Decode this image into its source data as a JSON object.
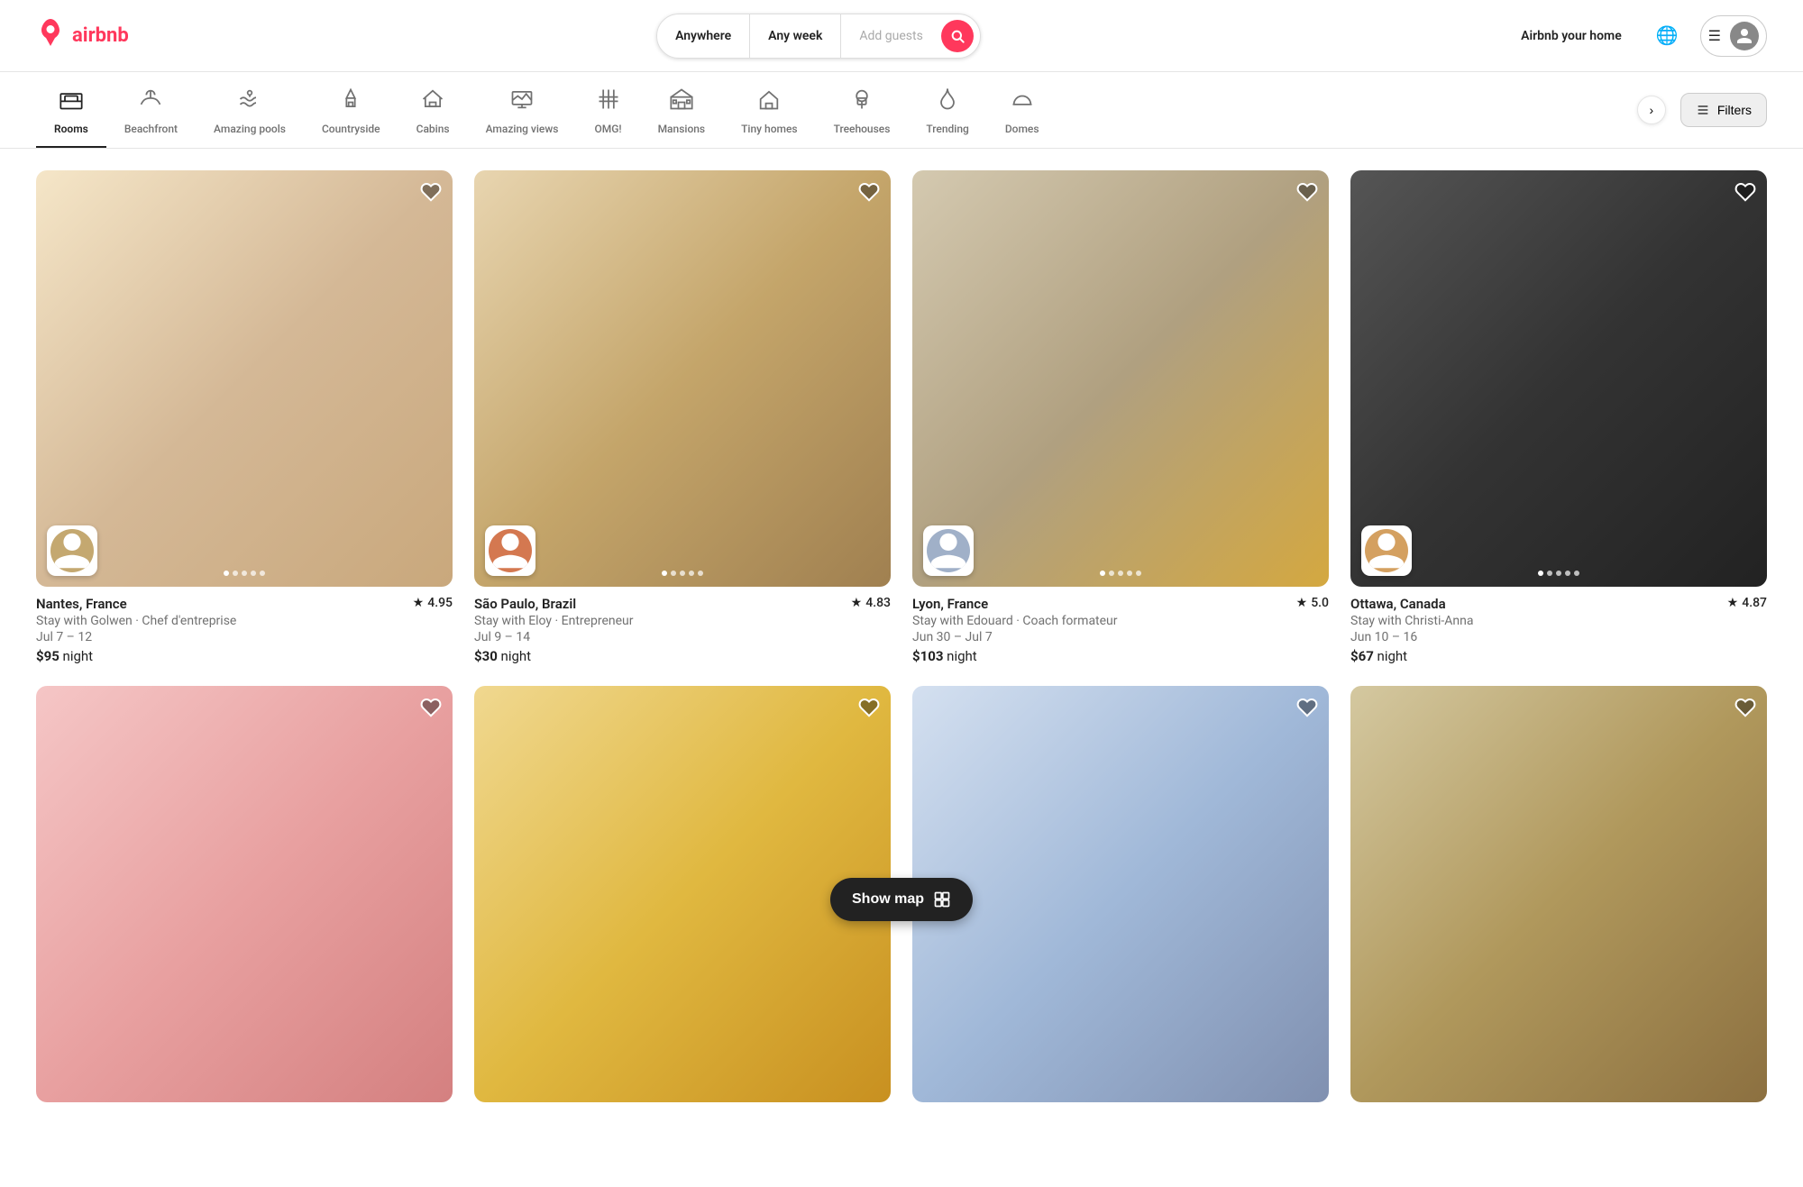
{
  "header": {
    "logo_text": "airbnb",
    "search": {
      "location_label": "Anywhere",
      "week_label": "Any week",
      "guests_placeholder": "Add guests"
    },
    "host_link": "Airbnb your home",
    "globe_icon": "🌐",
    "menu_icon": "☰",
    "user_icon": "👤"
  },
  "categories": [
    {
      "id": "rooms",
      "label": "Rooms",
      "icon": "🛏"
    },
    {
      "id": "beachfront",
      "label": "Beachfront",
      "icon": "🏖"
    },
    {
      "id": "amazing-pools",
      "label": "Amazing pools",
      "icon": "🏊"
    },
    {
      "id": "countryside",
      "label": "Countryside",
      "icon": "🌲"
    },
    {
      "id": "cabins",
      "label": "Cabins",
      "icon": "🏚"
    },
    {
      "id": "amazing-views",
      "label": "Amazing views",
      "icon": "🖼"
    },
    {
      "id": "omg",
      "label": "OMG!",
      "icon": "🏠"
    },
    {
      "id": "mansions",
      "label": "Mansions",
      "icon": "🏛"
    },
    {
      "id": "tiny-homes",
      "label": "Tiny homes",
      "icon": "🏠"
    },
    {
      "id": "treehouses",
      "label": "Treehouses",
      "icon": "🌳"
    },
    {
      "id": "trending",
      "label": "Trending",
      "icon": "🔥"
    },
    {
      "id": "domes",
      "label": "Domes",
      "icon": "⛺"
    }
  ],
  "filters_label": "Filters",
  "listings": [
    {
      "id": "nantes",
      "location": "Nantes, France",
      "rating": "4.95",
      "subtitle": "Stay with Golwen · Chef d'entreprise",
      "dates": "Jul 7 – 12",
      "price_per_night": "$95",
      "price_label": "night",
      "img_class": "img-nantes",
      "dots": 5,
      "active_dot": 0
    },
    {
      "id": "sao-paulo",
      "location": "São Paulo, Brazil",
      "rating": "4.83",
      "subtitle": "Stay with Eloy · Entrepreneur",
      "dates": "Jul 9 – 14",
      "price_per_night": "$30",
      "price_label": "night",
      "img_class": "img-sao-paulo",
      "dots": 5,
      "active_dot": 0
    },
    {
      "id": "lyon",
      "location": "Lyon, France",
      "rating": "5.0",
      "subtitle": "Stay with Edouard · Coach formateur",
      "dates": "Jun 30 – Jul 7",
      "price_per_night": "$103",
      "price_label": "night",
      "img_class": "img-lyon",
      "dots": 5,
      "active_dot": 0
    },
    {
      "id": "ottawa",
      "location": "Ottawa, Canada",
      "rating": "4.87",
      "subtitle": "Stay with Christi-Anna",
      "dates": "Jun 10 – 16",
      "price_per_night": "$67",
      "price_label": "night",
      "img_class": "img-ottawa",
      "dots": 5,
      "active_dot": 0
    },
    {
      "id": "bottom1",
      "location": "",
      "rating": "",
      "subtitle": "",
      "dates": "",
      "price_per_night": "",
      "price_label": "",
      "img_class": "img-bottom1",
      "dots": 0,
      "active_dot": 0
    },
    {
      "id": "bottom2",
      "location": "",
      "rating": "",
      "subtitle": "",
      "dates": "",
      "price_per_night": "",
      "price_label": "",
      "img_class": "img-bottom2",
      "dots": 0,
      "active_dot": 0
    },
    {
      "id": "bottom3",
      "location": "",
      "rating": "",
      "subtitle": "",
      "dates": "",
      "price_per_night": "",
      "price_label": "",
      "img_class": "img-bottom3",
      "dots": 0,
      "active_dot": 0
    },
    {
      "id": "bottom4",
      "location": "",
      "rating": "",
      "subtitle": "",
      "dates": "",
      "price_per_night": "",
      "price_label": "",
      "img_class": "img-bottom4",
      "dots": 0,
      "active_dot": 0
    }
  ],
  "show_map": {
    "label": "Show map",
    "icon": "⊞"
  }
}
